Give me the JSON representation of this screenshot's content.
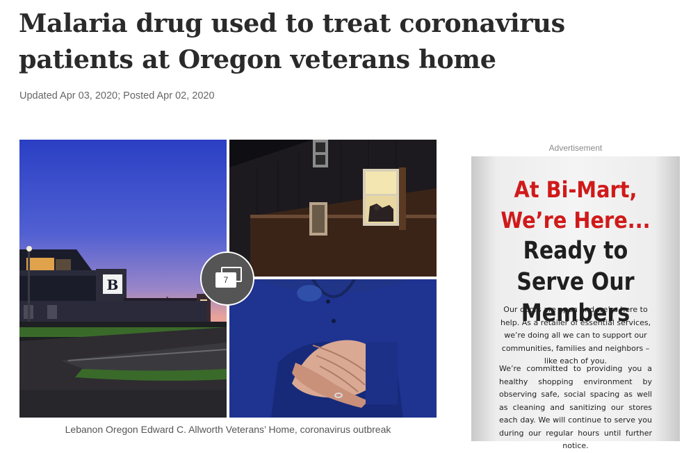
{
  "article": {
    "headline": "Malaria drug used to treat coronavirus patients at Oregon veterans home",
    "dateline": "Updated Apr 03, 2020; Posted Apr 02, 2020"
  },
  "gallery": {
    "photo_count": "7",
    "caption": "Lebanon Oregon Edward C. Allworth Veterans’ Home, coronavirus outbreak",
    "count_icon": "photo-stack-icon",
    "building_sign_letter": "B"
  },
  "advertisement": {
    "label": "Advertisement",
    "headline_red": "At Bi-Mart, We’re Here...",
    "headline_dark": "Ready to Serve Our Members",
    "body_1": "Our doors are open and we’re here to help. As a retailer of essential services, we’re doing all we can to support our communities, families and neighbors – like each of you.",
    "body_2": "We’re committed to providing you a healthy shopping environment by observing safe, social spacing as well as cleaning and sanitizing our stores each day. We will continue to serve you during our regular hours until further notice.",
    "colors": {
      "headline_red": "#d01a1a",
      "headline_dark": "#1f1f1f"
    }
  }
}
